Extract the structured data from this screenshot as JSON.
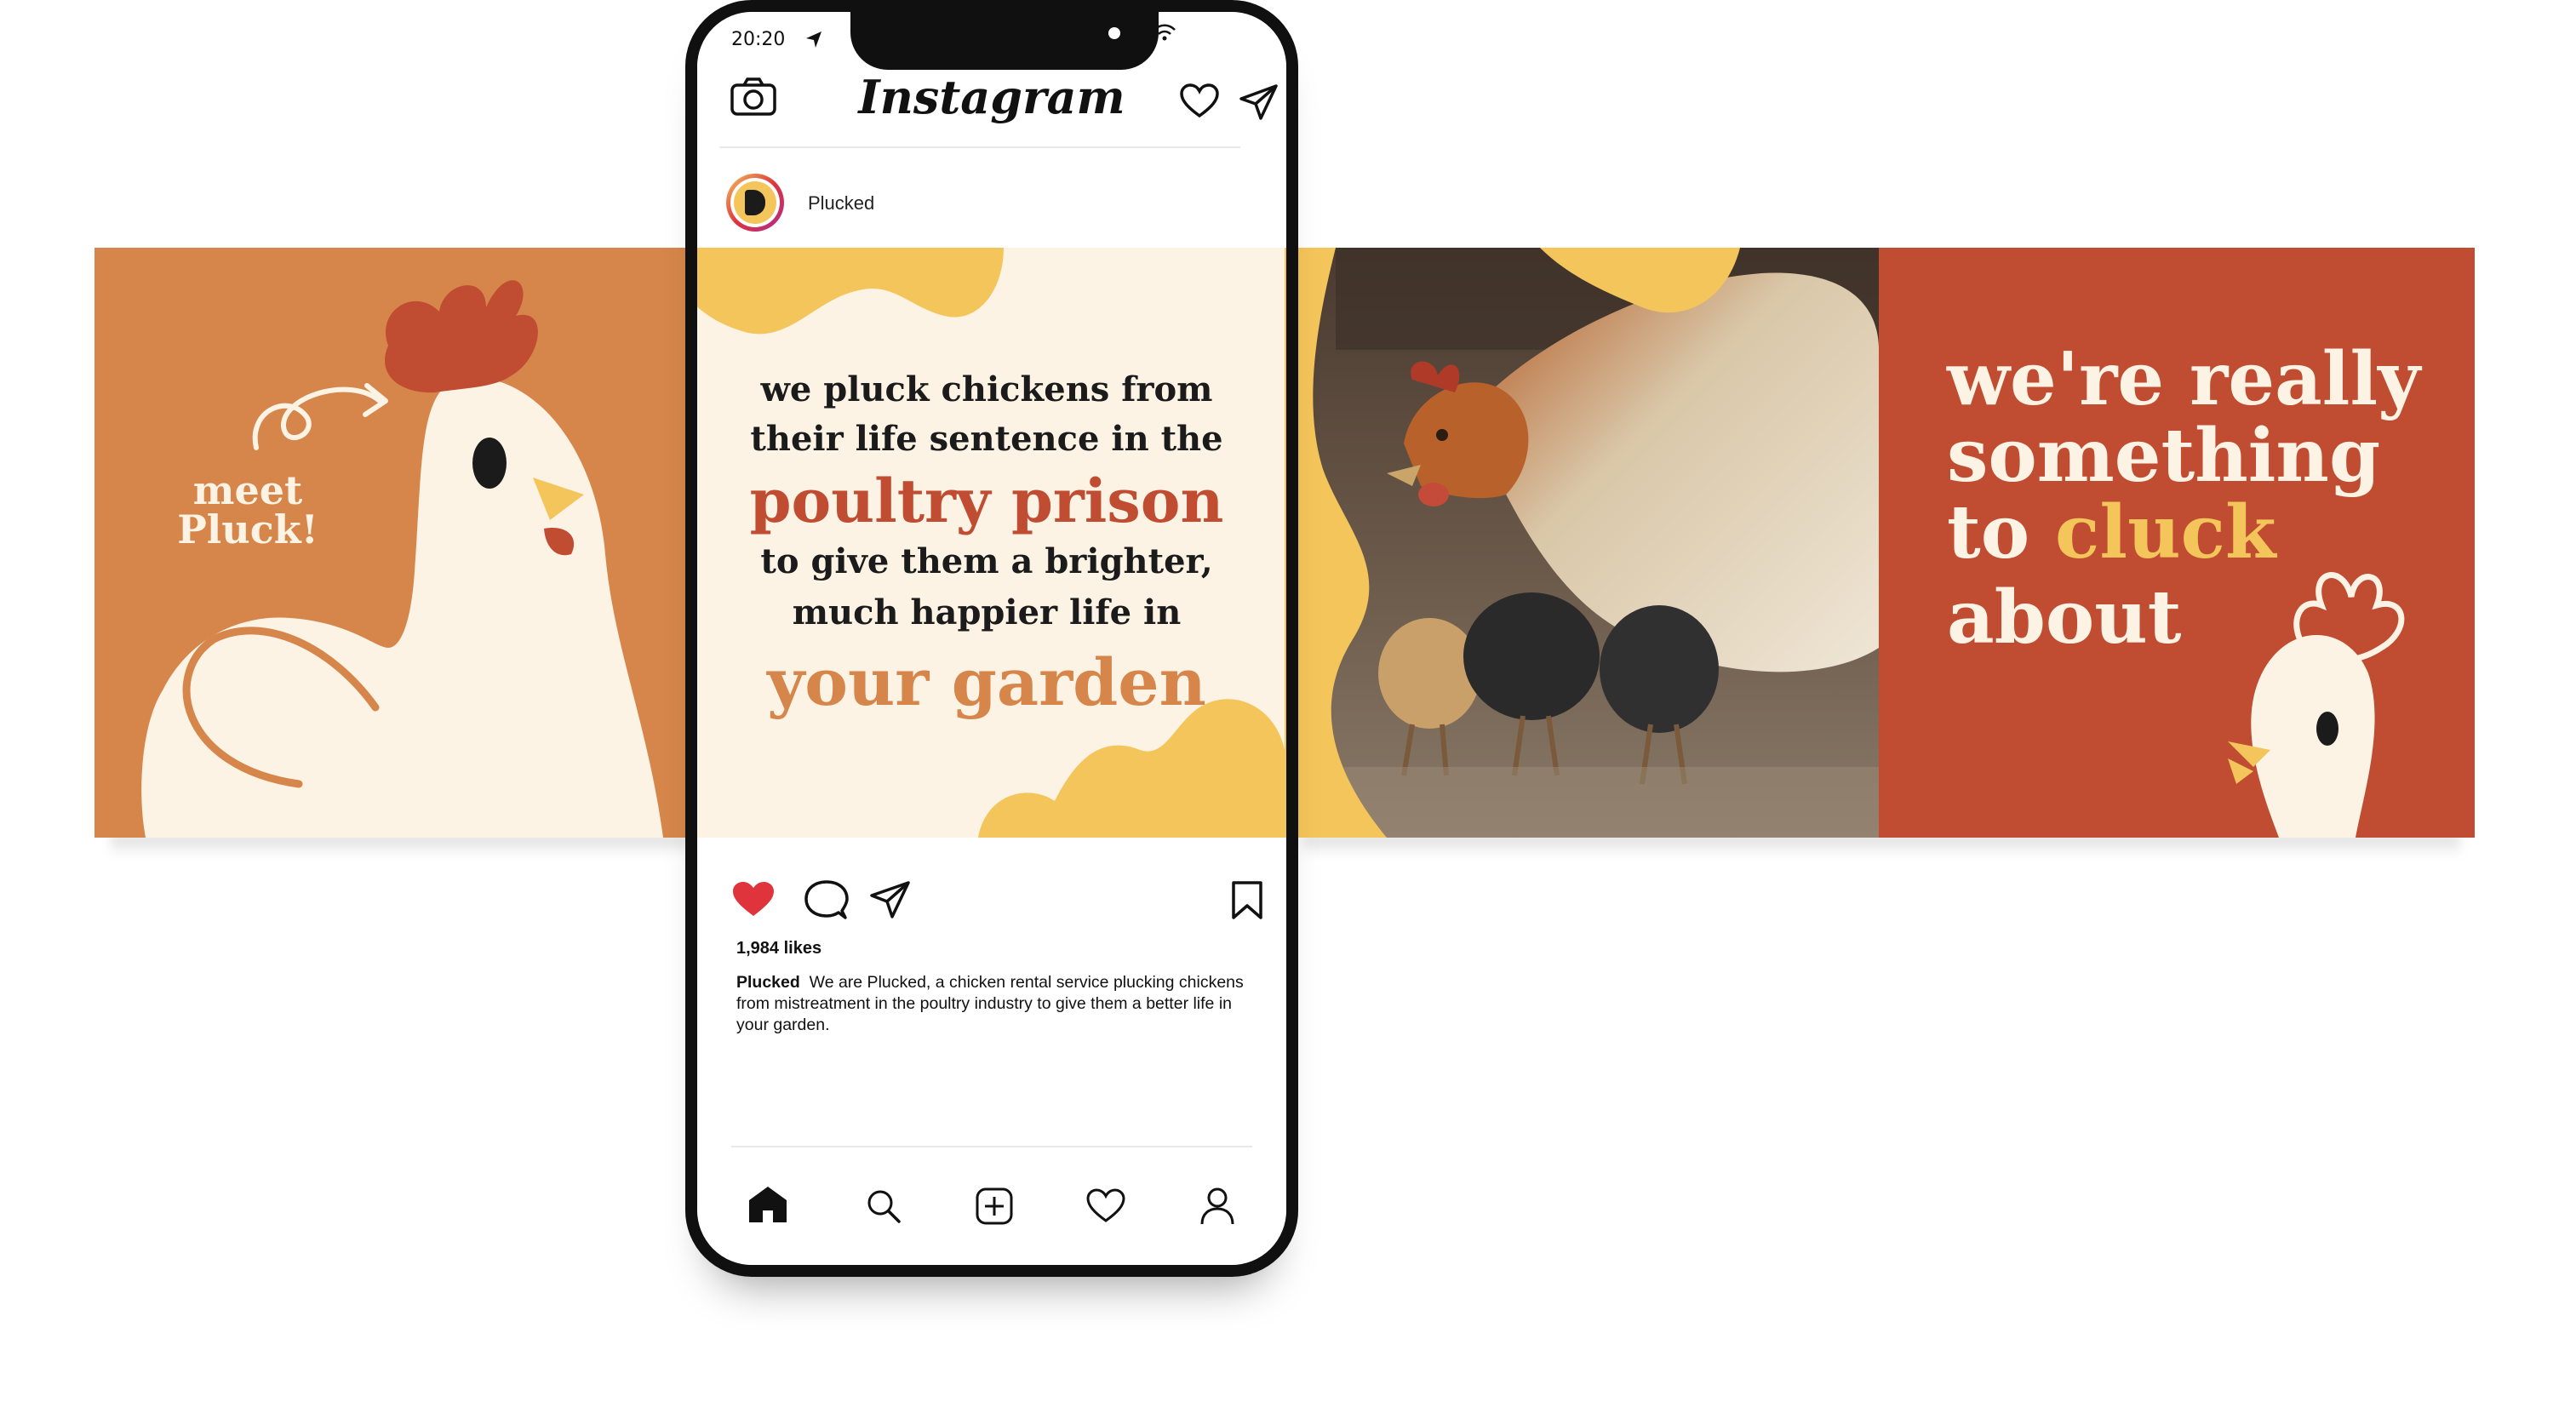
{
  "slides": {
    "meet": {
      "line1": "meet",
      "line2": "Pluck!"
    },
    "mission": {
      "line1": "we pluck chickens from",
      "line2": "their life sentence in the",
      "highlight1": "poultry prison",
      "line3": "to give them a brighter,",
      "line4": "much happier life in",
      "highlight2": "your garden"
    },
    "cluck": {
      "line1": "we're really",
      "line2": "something",
      "line3_prefix": "to ",
      "line3_highlight": "cluck",
      "line4": "about"
    }
  },
  "phone": {
    "status": {
      "time": "20:20"
    },
    "app_title": "Instagram",
    "post": {
      "author": "Plucked",
      "likes": "1,984 likes",
      "caption_author": "Plucked",
      "caption_text": "We are Plucked, a chicken rental service plucking chickens from mistreatment in the poultry industry to give them a better life in your garden."
    }
  },
  "icons": {
    "camera": "camera-icon",
    "heart": "heart-icon",
    "send": "send-icon",
    "like_filled": "heart-filled-icon",
    "comment": "comment-icon",
    "bookmark": "bookmark-icon",
    "home": "home-icon",
    "search": "search-icon",
    "add": "add-post-icon",
    "activity": "heart-icon",
    "profile": "profile-icon"
  },
  "colors": {
    "orange": "#d6864a",
    "cream": "#fcf3e5",
    "yellow": "#f4c55a",
    "red": "#c04c32",
    "like_red": "#e0343c"
  }
}
